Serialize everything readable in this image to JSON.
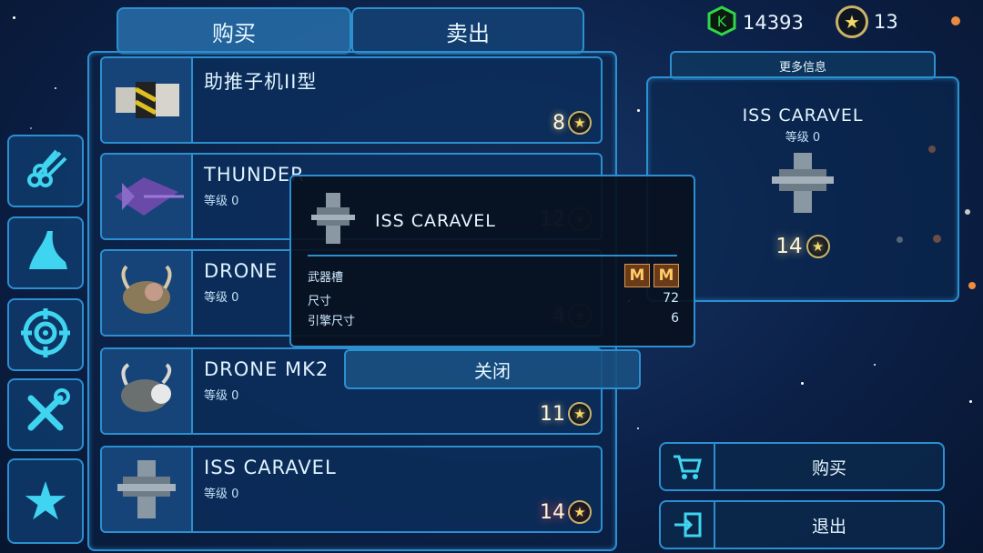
{
  "tabs": {
    "buy": "购买",
    "sell": "卖出"
  },
  "currency": {
    "credits": "14393",
    "stars": "13"
  },
  "categories": [
    {
      "icon": "pipes-icon"
    },
    {
      "icon": "hull-icon"
    },
    {
      "icon": "target-icon"
    },
    {
      "icon": "tools-icon"
    },
    {
      "icon": "star-icon"
    }
  ],
  "items": [
    {
      "name": "助推子机II型",
      "level": "",
      "price": "8",
      "icon": "booster-icon"
    },
    {
      "name": "THUNDER",
      "level": "等级 0",
      "price": "12",
      "icon": "thunder-ship-icon"
    },
    {
      "name": "DRONE",
      "level": "等级 0",
      "price": "4",
      "icon": "drone-icon"
    },
    {
      "name": "DRONE MK2",
      "level": "等级 0",
      "price": "11",
      "icon": "drone-mk2-icon"
    },
    {
      "name": "ISS CARAVEL",
      "level": "等级 0",
      "price": "14",
      "icon": "caravel-icon"
    }
  ],
  "detail": {
    "more_info": "更多信息",
    "name": "ISS CARAVEL",
    "level": "等级 0",
    "price": "14"
  },
  "dialog": {
    "title": "ISS CARAVEL",
    "weapon_slots_label": "武器槽",
    "weapon_slots": [
      "M",
      "M"
    ],
    "size_label": "尺寸",
    "size_value": "72",
    "engine_label": "引擎尺寸",
    "engine_value": "6",
    "close_label": "关闭"
  },
  "actions": {
    "buy": "购买",
    "exit": "退出"
  },
  "colors": {
    "frame": "#2c8fd0",
    "price_glow": "#ffdc8c",
    "slot": "#6b3a18"
  }
}
